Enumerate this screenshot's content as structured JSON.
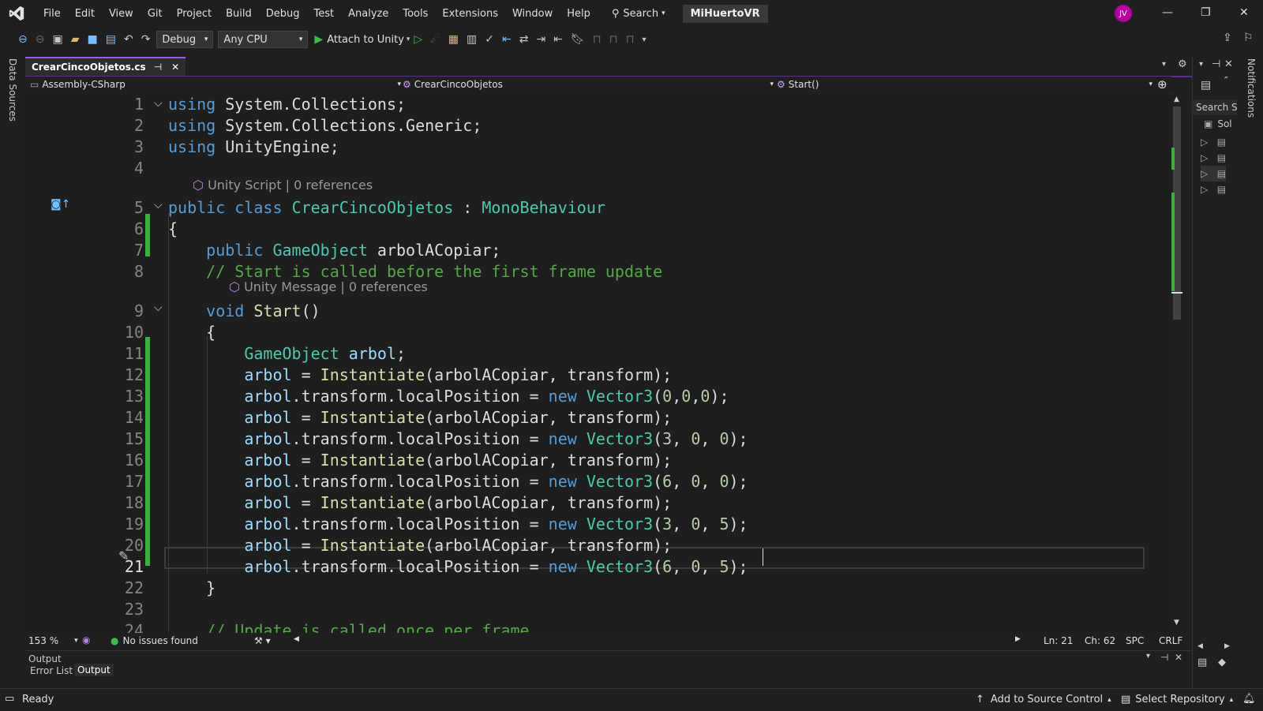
{
  "menu": [
    "File",
    "Edit",
    "View",
    "Git",
    "Project",
    "Build",
    "Debug",
    "Test",
    "Analyze",
    "Tools",
    "Extensions",
    "Window",
    "Help"
  ],
  "search_label": "Search",
  "solution_name": "MiHuertoVR",
  "avatar_initials": "JV",
  "toolbar": {
    "config": "Debug",
    "platform": "Any CPU",
    "attach": "Attach to Unity"
  },
  "left_strip_label": "Data Sources",
  "right_strip_label": "Notifications",
  "tab": {
    "name": "CrearCincoObjetos.cs"
  },
  "nav": {
    "project": "Assembly-CSharp",
    "class": "CrearCincoObjetos",
    "member": "Start()"
  },
  "code_lines": [
    {
      "n": "1",
      "html": "<span class='kw'>using</span> System.Collections;"
    },
    {
      "n": "2",
      "html": "<span class='kw'>using</span> System.Collections.Generic;"
    },
    {
      "n": "3",
      "html": "<span class='kw'>using</span> UnityEngine;"
    },
    {
      "n": "4",
      "html": ""
    },
    {
      "n": "5",
      "html": "<span class='kw'>public</span> <span class='kw'>class</span> <span class='ty'>CrearCincoObjetos</span> : <span class='ty'>MonoBehaviour</span>"
    },
    {
      "n": "6",
      "html": "{"
    },
    {
      "n": "7",
      "html": "    <span class='kw'>public</span> <span class='ty'>GameObject</span> arbolACopiar;"
    },
    {
      "n": "8",
      "html": "    <span class='cm'>// Start is called before the first frame update</span>"
    },
    {
      "n": "9",
      "html": "    <span class='kw'>void</span> <span class='fn'>Start</span>()"
    },
    {
      "n": "10",
      "html": "    {"
    },
    {
      "n": "11",
      "html": "        <span class='ty'>GameObject</span> <span class='vr'>arbol</span>;"
    },
    {
      "n": "12",
      "html": "        <span class='vr'>arbol</span> = <span class='fn'>Instantiate</span>(arbolACopiar, transform);"
    },
    {
      "n": "13",
      "html": "        <span class='vr'>arbol</span>.transform.localPosition = <span class='kw'>new</span> <span class='ty'>Vector3</span>(<span class='num'>0</span>,<span class='num'>0</span>,<span class='num'>0</span>);"
    },
    {
      "n": "14",
      "html": "        <span class='vr'>arbol</span> = <span class='fn'>Instantiate</span>(arbolACopiar, transform);"
    },
    {
      "n": "15",
      "html": "        <span class='vr'>arbol</span>.transform.localPosition = <span class='kw'>new</span> <span class='ty'>Vector3</span>(<span class='num'>3</span>, <span class='num'>0</span>, <span class='num'>0</span>);"
    },
    {
      "n": "16",
      "html": "        <span class='vr'>arbol</span> = <span class='fn'>Instantiate</span>(arbolACopiar, transform);"
    },
    {
      "n": "17",
      "html": "        <span class='vr'>arbol</span>.transform.localPosition = <span class='kw'>new</span> <span class='ty'>Vector3</span>(<span class='num'>6</span>, <span class='num'>0</span>, <span class='num'>0</span>);"
    },
    {
      "n": "18",
      "html": "        <span class='vr'>arbol</span> = <span class='fn'>Instantiate</span>(arbolACopiar, transform);"
    },
    {
      "n": "19",
      "html": "        <span class='vr'>arbol</span>.transform.localPosition = <span class='kw'>new</span> <span class='ty'>Vector3</span>(<span class='num'>3</span>, <span class='num'>0</span>, <span class='num'>5</span>);"
    },
    {
      "n": "20",
      "html": "        <span class='vr'>arbol</span> = <span class='fn'>Instantiate</span>(arbolACopiar, transform);"
    },
    {
      "n": "21",
      "html": "        <span class='vr'>arbol</span>.transform.localPosition = <span class='kw'>new</span> <span class='ty'>Vector3</span>(<span class='num'>6</span>, <span class='num'>0</span>, <span class='num'>5</span>);"
    },
    {
      "n": "22",
      "html": "    }"
    },
    {
      "n": "23",
      "html": ""
    },
    {
      "n": "24",
      "html": "    <span class='cm'>// Update is called once per frame</span>"
    }
  ],
  "codelens": {
    "class_lens": "Unity Script | 0 references",
    "method_lens": "Unity Message | 0 references"
  },
  "editor_status": {
    "zoom": "153 %",
    "issues": "No issues found",
    "line": "Ln: 21",
    "char": "Ch: 62",
    "spacing": "SPC",
    "eol": "CRLF"
  },
  "output": {
    "title": "Output",
    "tab1": "Error List",
    "tab2": "Output"
  },
  "right_panel": {
    "search": "Search S",
    "solution": "Sol"
  },
  "status": {
    "ready": "Ready",
    "source_control": "Add to Source Control",
    "repo": "Select Repository"
  },
  "colors": {
    "accent": "#9d5ddb",
    "added_lines": "#3fae3f",
    "keyword": "#569cd6",
    "type": "#4ec9b0"
  }
}
